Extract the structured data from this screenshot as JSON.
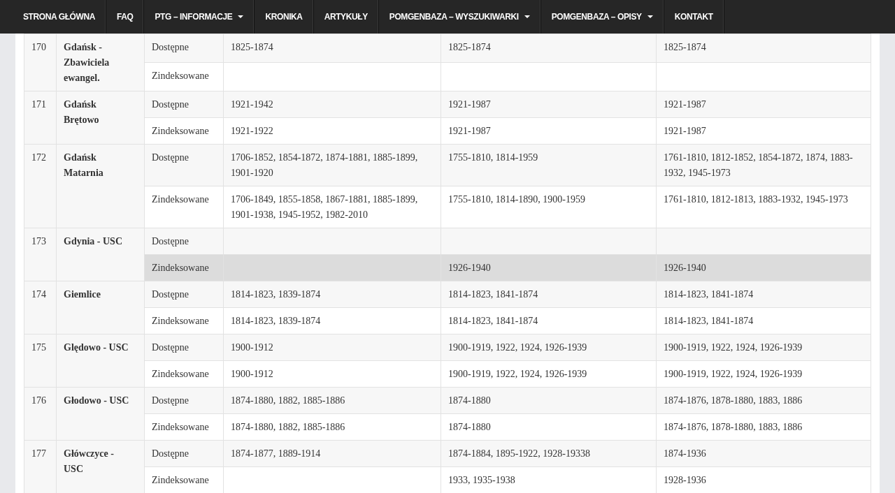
{
  "nav": [
    {
      "label": "STRONA GŁÓWNA",
      "dropdown": false
    },
    {
      "label": "FAQ",
      "dropdown": false
    },
    {
      "label": "PTG – INFORMACJE",
      "dropdown": true
    },
    {
      "label": "KRONIKA",
      "dropdown": false
    },
    {
      "label": "ARTYKUŁY",
      "dropdown": false
    },
    {
      "label": "POMGENBAZA – WYSZUKIWARKI",
      "dropdown": true
    },
    {
      "label": "POMGENBAZA – OPISY",
      "dropdown": true
    },
    {
      "label": "KONTAKT",
      "dropdown": false
    }
  ],
  "table": {
    "rows": [
      {
        "number": "170",
        "name": "Gdańsk - Zbawiciela ewangel.",
        "entries": [
          {
            "type": "Dostępne",
            "values": {
              "column_1": "1825-1874",
              "column_2": "1825-1874",
              "column_3": "1825-1874"
            },
            "highlighted": false
          },
          {
            "type": "Zindeksowane",
            "highlighted": false
          }
        ]
      },
      {
        "number": "171",
        "name": "Gdańsk Brętowo",
        "entries": [
          {
            "type": "Dostępne",
            "values": {
              "column_1": "1921-1942",
              "column_2": "1921-1987",
              "column_3": "1921-1987"
            },
            "highlighted": false
          },
          {
            "type": "Zindeksowane",
            "values": {
              "column_1": "1921-1922",
              "column_2": "1921-1987",
              "column_3": "1921-1987"
            },
            "highlighted": false
          }
        ]
      },
      {
        "number": "172",
        "name": "Gdańsk Matarnia",
        "entries": [
          {
            "type": "Dostępne",
            "values": {
              "column_1": "1706-1852, 1854-1872, 1874-1881, 1885-1899, 1901-1920",
              "column_2": "1755-1810, 1814-1959",
              "column_3": "1761-1810, 1812-1852, 1854-1872, 1874, 1883-1932, 1945-1973"
            },
            "highlighted": false
          },
          {
            "type": "Zindeksowane",
            "values": {
              "column_1": "1706-1849, 1855-1858, 1867-1881, 1885-1899, 1901-1938, 1945-1952, 1982-2010",
              "column_2": "1755-1810, 1814-1890, 1900-1959",
              "column_3": "1761-1810, 1812-1813, 1883-1932, 1945-1973"
            },
            "highlighted": false
          }
        ]
      },
      {
        "number": "173",
        "name": "Gdynia - USC",
        "entries": [
          {
            "type": "Dostępne",
            "highlighted": false
          },
          {
            "type": "Zindeksowane",
            "values": {
              "column_2": "1926-1940",
              "column_3": "1926-1940"
            },
            "highlighted": true
          }
        ]
      },
      {
        "number": "174",
        "name": "Giemlice",
        "entries": [
          {
            "type": "Dostępne",
            "values": {
              "column_1": "1814-1823, 1839-1874",
              "column_2": "1814-1823, 1841-1874",
              "column_3": "1814-1823, 1841-1874"
            },
            "highlighted": false
          },
          {
            "type": "Zindeksowane",
            "values": {
              "column_1": "1814-1823, 1839-1874",
              "column_2": "1814-1823, 1841-1874",
              "column_3": "1814-1823, 1841-1874"
            },
            "highlighted": false
          }
        ]
      },
      {
        "number": "175",
        "name": "Ględowo - USC",
        "entries": [
          {
            "type": "Dostępne",
            "values": {
              "column_1": "1900-1912",
              "column_2": "1900-1919, 1922, 1924, 1926-1939",
              "column_3": "1900-1919, 1922, 1924, 1926-1939"
            },
            "highlighted": false
          },
          {
            "type": "Zindeksowane",
            "values": {
              "column_1": "1900-1912",
              "column_2": "1900-1919, 1922, 1924, 1926-1939",
              "column_3": "1900-1919, 1922, 1924, 1926-1939"
            },
            "highlighted": false
          }
        ]
      },
      {
        "number": "176",
        "name": "Głodowo - USC",
        "entries": [
          {
            "type": "Dostępne",
            "values": {
              "column_1": "1874-1880, 1882, 1885-1886",
              "column_2": "1874-1880",
              "column_3": "1874-1876, 1878-1880, 1883, 1886"
            },
            "highlighted": false
          },
          {
            "type": "Zindeksowane",
            "values": {
              "column_1": "1874-1880, 1882, 1885-1886",
              "column_2": "1874-1880",
              "column_3": "1874-1876, 1878-1880, 1883, 1886"
            },
            "highlighted": false
          }
        ]
      },
      {
        "number": "177",
        "name": "Główczyce - USC",
        "entries": [
          {
            "type": "Dostępne",
            "values": {
              "column_1": "1874-1877, 1889-1914",
              "column_2": "1874-1884, 1895-1922, 1928-19338",
              "column_3": "1874-1936"
            },
            "highlighted": false
          },
          {
            "type": "Zindeksowane",
            "values": {
              "column_2": "1933, 1935-1938",
              "column_3": "1928-1936"
            },
            "highlighted": false
          }
        ]
      }
    ]
  }
}
